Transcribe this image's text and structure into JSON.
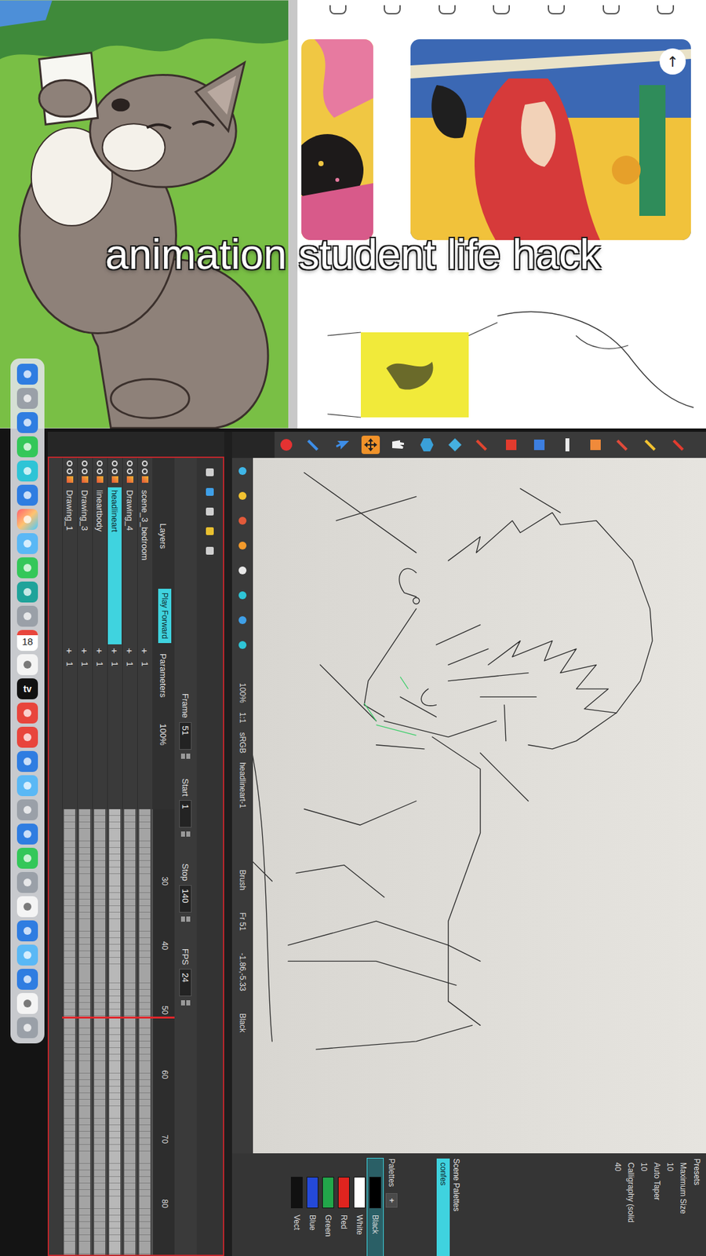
{
  "caption": "animation student life hack",
  "browser": {
    "scroll_top_button": "↑"
  },
  "dock": {
    "calendar_date": "18",
    "tv_label": "tv"
  },
  "toolbar": {
    "tools": [
      {
        "selected": false
      },
      {
        "selected": false
      },
      {
        "selected": false
      },
      {
        "selected": false
      },
      {
        "selected": false
      },
      {
        "selected": false
      },
      {
        "selected": false
      },
      {
        "selected": false
      },
      {
        "selected": false
      },
      {
        "selected": false
      },
      {
        "selected": false
      },
      {
        "selected": true
      },
      {
        "selected": false
      },
      {
        "selected": false
      },
      {
        "selected": false
      }
    ]
  },
  "camera_status": {
    "zoom": "100%",
    "ratio": "1:1",
    "color_space": "sRGB",
    "drawing": "headlineart-1",
    "tool": "Brush",
    "frame": "Fr 51",
    "coords": "-1.86,-5.33",
    "color": "Black"
  },
  "palettes": {
    "presets_title": "Presets",
    "presets": [
      "Maximum Size",
      "10",
      "Auto Taper",
      "10",
      "Calligraphy (solid",
      "40"
    ],
    "scene_palettes_title": "Scene Palettes",
    "palette_list": [
      {
        "name": "confes",
        "selected": true
      }
    ],
    "palettes_title": "Palettes",
    "add": "+",
    "colors": [
      {
        "name": "Black",
        "color": "#000000",
        "selected": true
      },
      {
        "name": "White",
        "color": "#ffffff",
        "selected": false
      },
      {
        "name": "Red",
        "color": "#e0241f",
        "selected": false
      },
      {
        "name": "Green",
        "color": "#22a64a",
        "selected": false
      },
      {
        "name": "Blue",
        "color": "#2449d8",
        "selected": false
      },
      {
        "name": "Vect",
        "color": "#111111",
        "selected": false
      }
    ]
  },
  "timeline": {
    "tooltip": "Play Forward",
    "layers_title": "Layers",
    "parameters_title": "Parameters",
    "opacity": "100%",
    "fields": [
      {
        "label": "Frame",
        "value": "51"
      },
      {
        "label": "Start",
        "value": "1"
      },
      {
        "label": "Stop",
        "value": "140"
      },
      {
        "label": "FPS",
        "value": "24"
      }
    ],
    "ticks": [
      "30",
      "40",
      "50",
      "60",
      "70",
      "80"
    ],
    "layers": [
      {
        "name": "scene_3_bedroom",
        "selected": false,
        "add": "+",
        "count": "1"
      },
      {
        "name": "Drawing_4",
        "selected": false,
        "add": "+",
        "count": "1"
      },
      {
        "name": "headlineart",
        "selected": true,
        "add": "+",
        "count": "1"
      },
      {
        "name": "lineartbody",
        "selected": false,
        "add": "+",
        "count": "1"
      },
      {
        "name": "Drawing_3",
        "selected": false,
        "add": "+",
        "count": "1"
      },
      {
        "name": "Drawing_1",
        "selected": false,
        "add": "+",
        "count": "1"
      }
    ]
  }
}
